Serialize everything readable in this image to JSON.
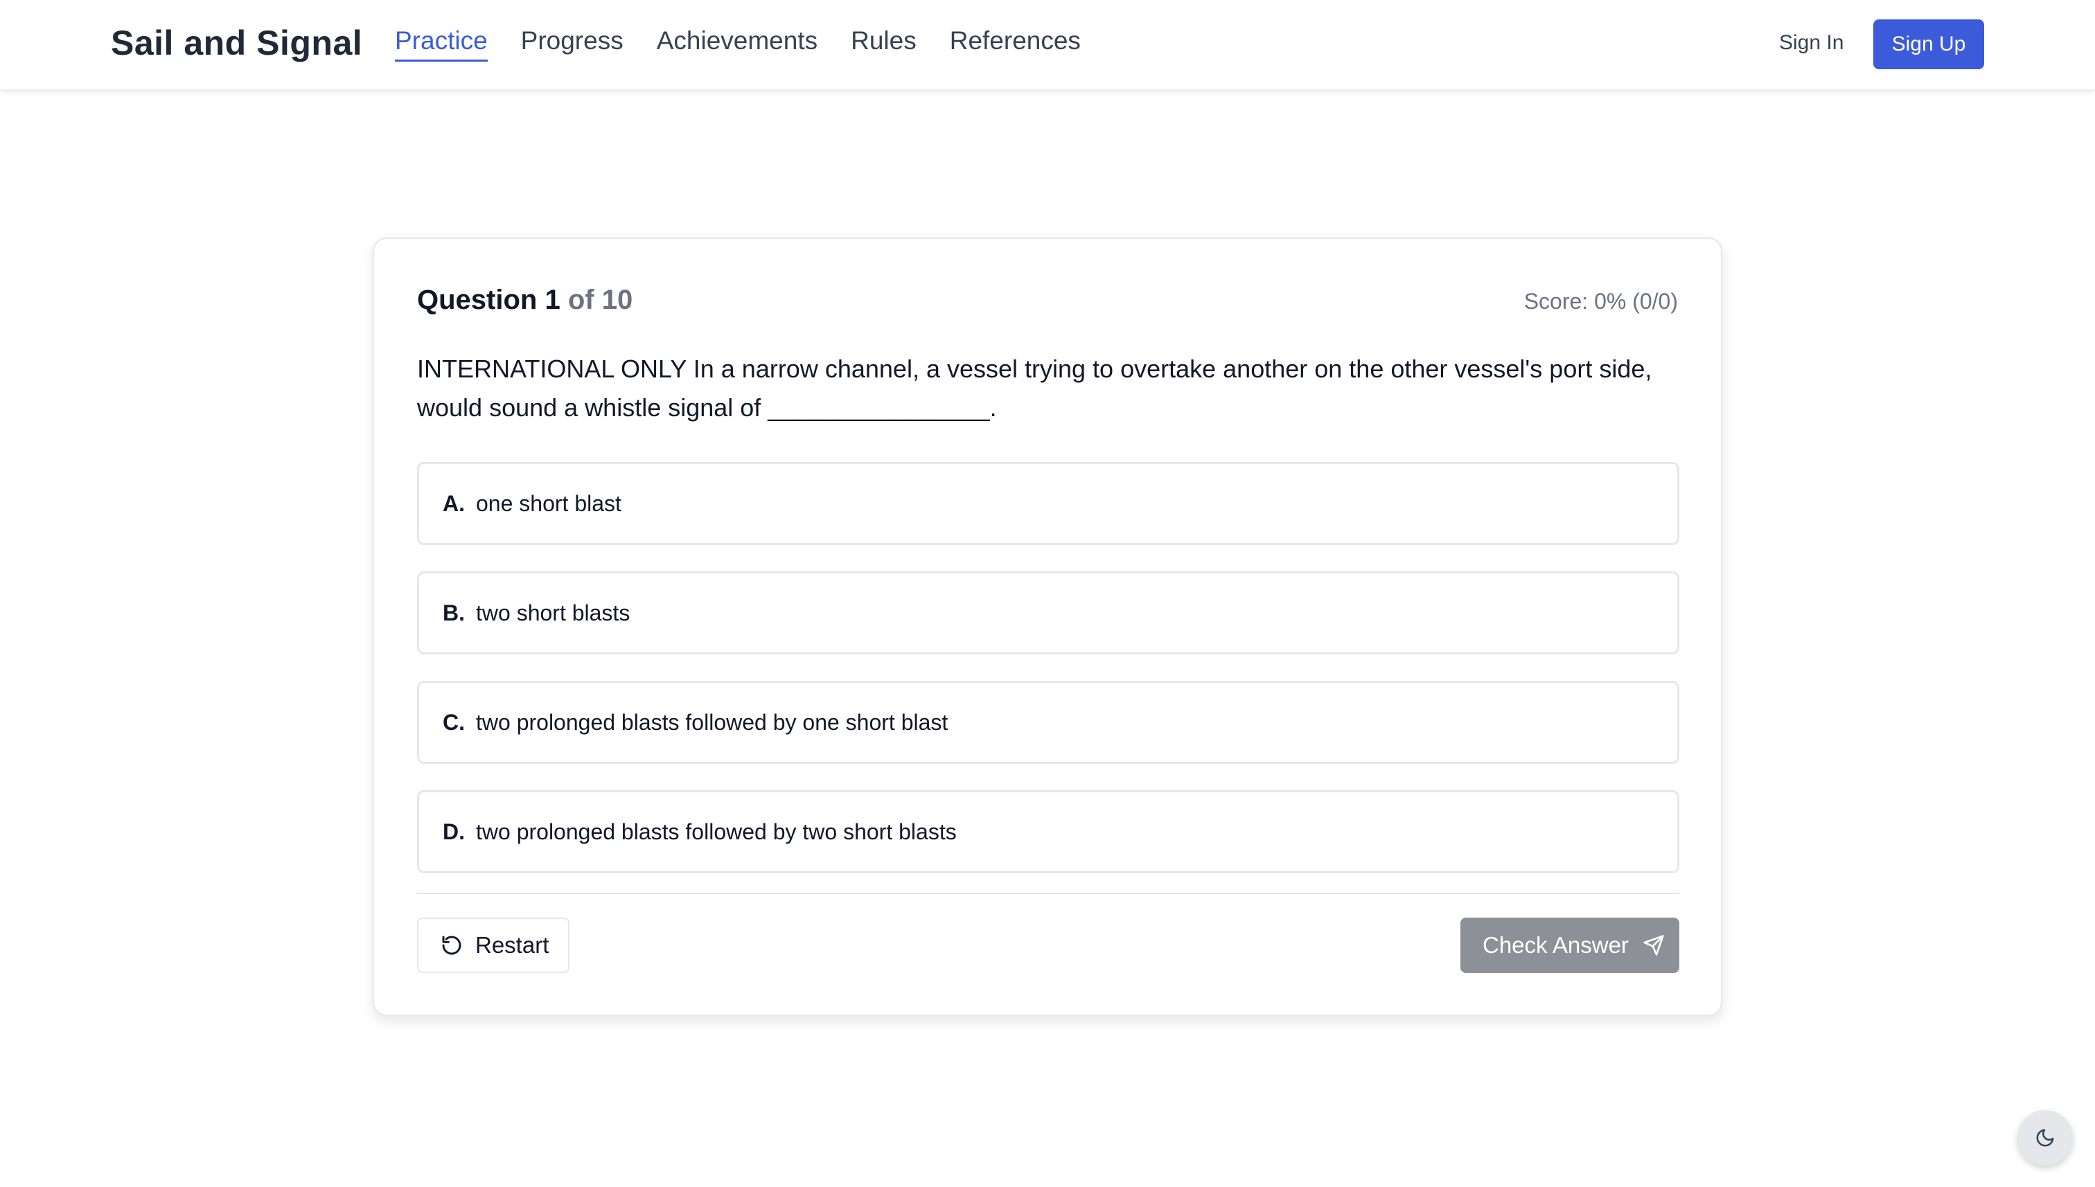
{
  "header": {
    "brand": "Sail and Signal",
    "nav": [
      {
        "label": "Practice",
        "active": true
      },
      {
        "label": "Progress",
        "active": false
      },
      {
        "label": "Achievements",
        "active": false
      },
      {
        "label": "Rules",
        "active": false
      },
      {
        "label": "References",
        "active": false
      }
    ],
    "signin_label": "Sign In",
    "signup_label": "Sign Up"
  },
  "quiz": {
    "question_label": "Question 1",
    "question_total": "of 10",
    "score_text": "Score: 0% (0/0)",
    "question_text": "INTERNATIONAL ONLY In a narrow channel, a vessel trying to overtake another on the other vessel's port side, would sound a whistle signal of ________________.",
    "options": [
      {
        "letter": "A.",
        "text": "one short blast"
      },
      {
        "letter": "B.",
        "text": "two short blasts"
      },
      {
        "letter": "C.",
        "text": "two prolonged blasts followed by one short blast"
      },
      {
        "letter": "D.",
        "text": "two prolonged blasts followed by two short blasts"
      }
    ],
    "restart_label": "Restart",
    "check_label": "Check Answer"
  },
  "icons": {
    "restart": "rotate-ccw-icon",
    "check": "send-icon",
    "theme": "moon-icon"
  },
  "colors": {
    "accent": "#3b5bdb",
    "disabled_button": "#8d9096",
    "muted_text": "#6b7280"
  }
}
